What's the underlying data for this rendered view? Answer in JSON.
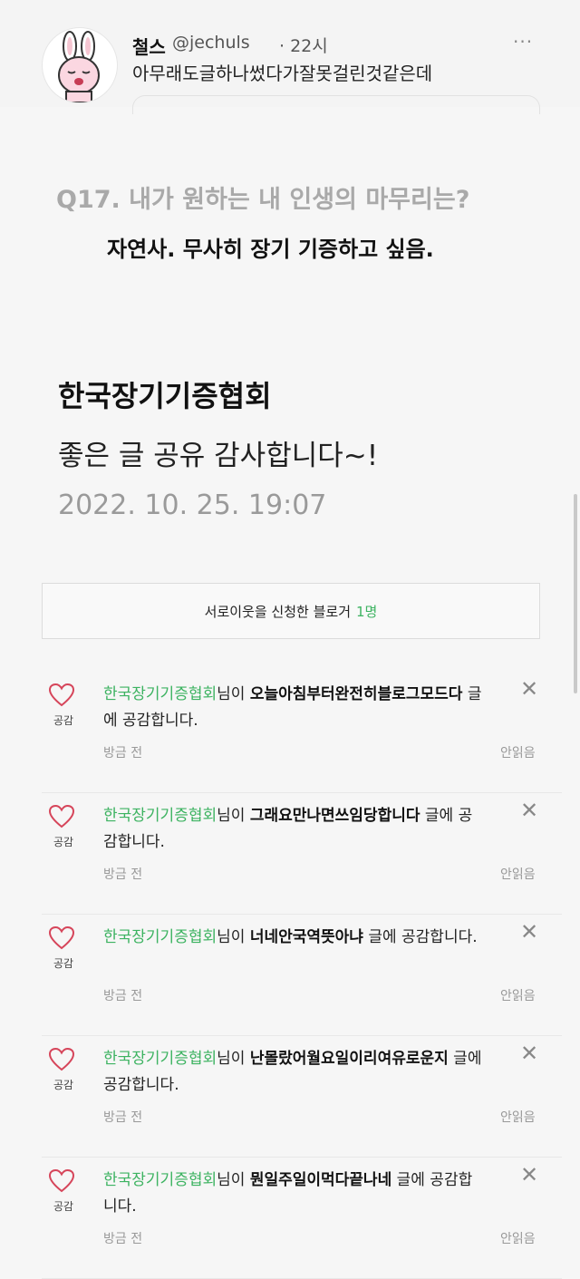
{
  "tweet": {
    "name": "철스",
    "handle": "@jechuls",
    "time": "· 22시",
    "text": "아무래도글하나썼다가잘못걸린것같은데",
    "more_icon": "more-icon"
  },
  "question": {
    "q": "Q17. 내가 원하는 내 인생의 마무리는?",
    "a": "자연사. 무사히 장기 기증하고 싶음."
  },
  "comment": {
    "author": "한국장기기증협회",
    "text": "좋은 글 공유 감사합니다~!",
    "date": "2022. 10. 25. 19:07"
  },
  "neighbor": {
    "label": "서로이웃을 신청한 블로거",
    "count": "1명"
  },
  "notifications": [
    {
      "heart_label": "공감",
      "name": "한국장기기증협회",
      "mid": "님이 ",
      "title": "오늘아침부터완전히블로그모드다",
      "suffix": " 글에 공감합니다.",
      "time": "방금 전",
      "unread": "안읽음"
    },
    {
      "heart_label": "공감",
      "name": "한국장기기증협회",
      "mid": "님이 ",
      "title": "그래요만나면쓰임당합니다",
      "suffix": " 글에 공감합니다.",
      "time": "방금 전",
      "unread": "안읽음"
    },
    {
      "heart_label": "공감",
      "name": "한국장기기증협회",
      "mid": "님이 ",
      "title": "너네안국역뜻아냐",
      "suffix": " 글에 공감합니다.",
      "time": "방금 전",
      "unread": "안읽음"
    },
    {
      "heart_label": "공감",
      "name": "한국장기기증협회",
      "mid": "님이 ",
      "title": "난몰랐어월요일이리여유로운지",
      "suffix": " 글에 공감합니다.",
      "time": "방금 전",
      "unread": "안읽음"
    },
    {
      "heart_label": "공감",
      "name": "한국장기기증협회",
      "mid": "님이 ",
      "title": "뭔일주일이먹다끝나네",
      "suffix": " 글에 공감합니다.",
      "time": "방금 전",
      "unread": "안읽음"
    }
  ],
  "icons": {
    "heart": "heart-icon",
    "close": "close-icon",
    "avatar": "bunny-avatar"
  },
  "colors": {
    "accent_green": "#3db361",
    "heart_red": "#d6455a"
  }
}
